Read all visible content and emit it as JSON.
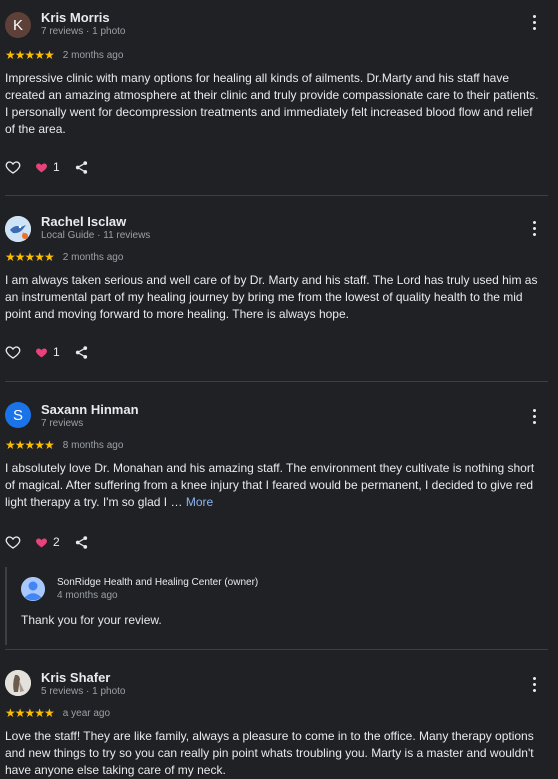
{
  "colors": {
    "background": "#202124",
    "text": "#e8eaed",
    "secondary_text": "#9aa0a6",
    "star": "#fbbc04",
    "heart": "#e8427a",
    "link": "#8ab4f8",
    "divider": "#3c4043"
  },
  "reviews": [
    {
      "name": "Kris Morris",
      "avatar_initial": "K",
      "avatar_color": "#5d4037",
      "sub": "7 reviews · 1 photo",
      "stars": "★★★★★",
      "rating": 5,
      "date": "2 months ago",
      "text": "Impressive clinic with many options for healing all kinds of ailments. Dr.Marty and his staff have created an amazing atmosphere at their clinic and truly provide compassionate care to their patients. I personally went for decompression treatments and immediately felt increased blood flow and relief of the area.",
      "likes": "1"
    },
    {
      "name": "Rachel Isclaw",
      "avatar_icon": "cartoon-bird-avatar",
      "sub": "Local Guide · 11 reviews",
      "stars": "★★★★★",
      "rating": 5,
      "date": "2 months ago",
      "text": "I am always taken serious and well care of by Dr. Marty and his staff. The Lord has truly used him as an instrumental part of my healing journey by bring me from the lowest of quality health to the mid point and moving forward to more healing. There is always hope.",
      "likes": "1"
    },
    {
      "name": "Saxann Hinman",
      "avatar_initial": "S",
      "avatar_color": "#1a73e8",
      "sub": "7 reviews",
      "stars": "★★★★★",
      "rating": 5,
      "date": "8 months ago",
      "text": "I absolutely love Dr. Monahan and his amazing staff. The environment they cultivate is nothing short of magical. After suffering from a knee injury that I feared would be permanent, I decided to give red light therapy a try. I'm so glad I …",
      "more_label": "More",
      "likes": "2",
      "reply": {
        "name": "SonRidge Health and Healing Center (owner)",
        "date": "4 months ago",
        "text": "Thank you for your review."
      }
    },
    {
      "name": "Kris Shafer",
      "avatar_icon": "photo-avatar",
      "sub": "5 reviews · 1 photo",
      "stars": "★★★★★",
      "rating": 5,
      "date": "a year ago",
      "text": "Love the staff! They are like family, always a pleasure to come in to the office. Many therapy options and new things to try so you can really pin point whats troubling you. Marty is a master and wouldn't have anyone else taking care of my neck."
    }
  ]
}
